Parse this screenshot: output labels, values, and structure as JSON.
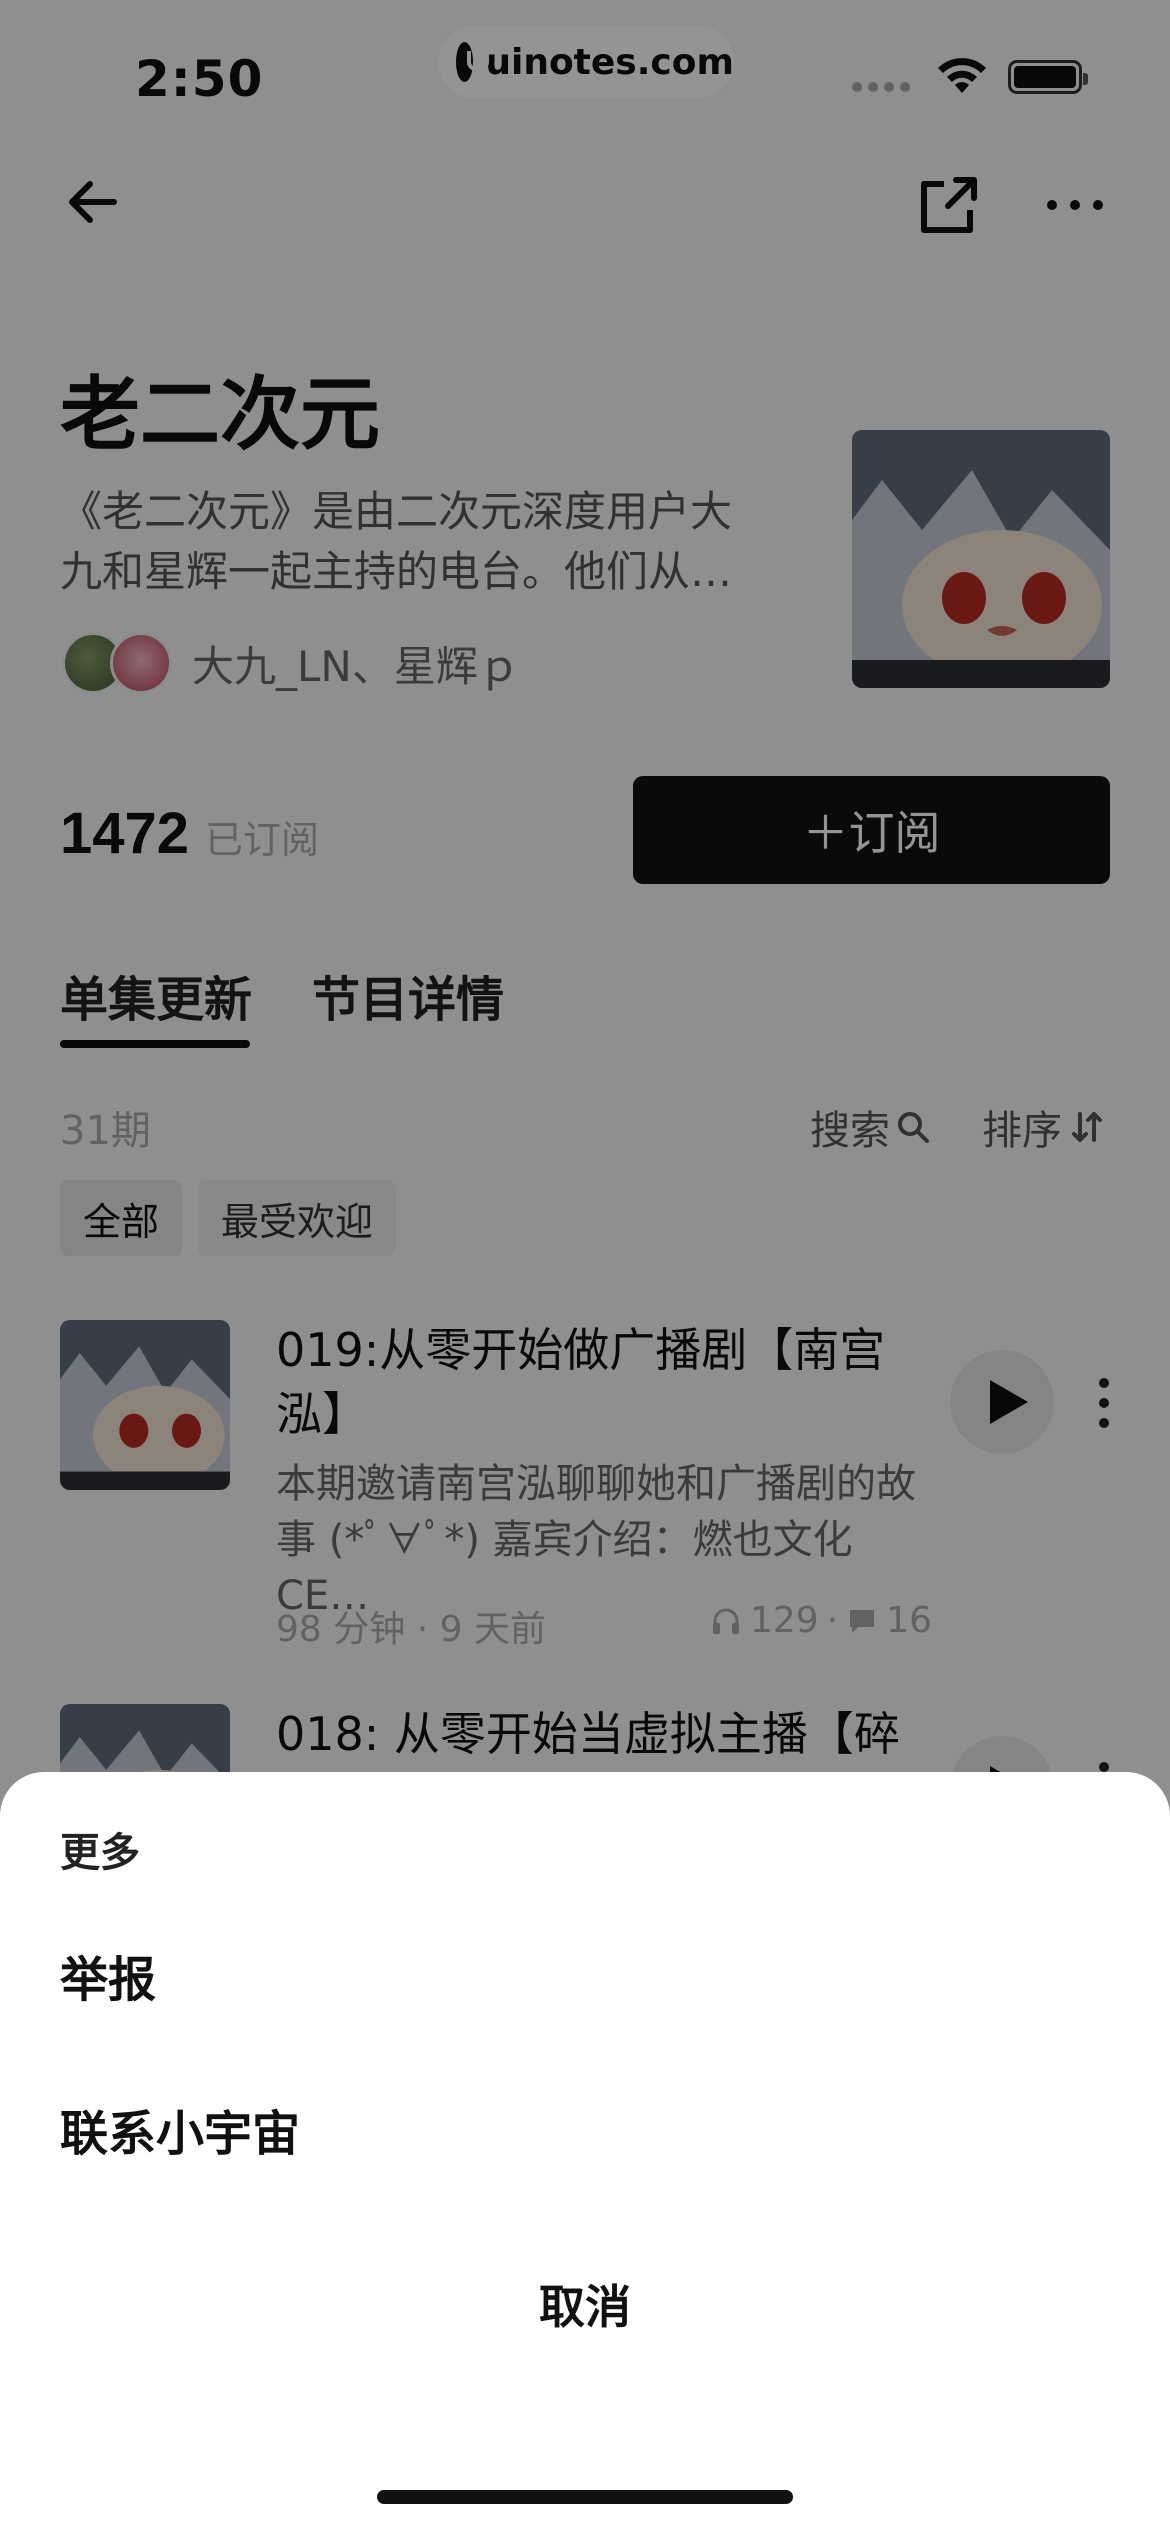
{
  "status_bar": {
    "time": "2:50",
    "url_badge": "uinotes.com"
  },
  "podcast": {
    "title": "老二次元",
    "description": "《老二次元》是由二次元深度用户大九和星辉一起主持的电台。他们从…",
    "hosts": "大九_LN、星辉ｐ",
    "subscriber_count": "1472",
    "subscriber_label": "已订阅",
    "subscribe_button": "＋订阅"
  },
  "tabs": [
    "单集更新",
    "节目详情"
  ],
  "episode_list": {
    "count": "31期",
    "search_label": "搜索",
    "sort_label": "排序",
    "filters": [
      "全部",
      "最受欢迎"
    ]
  },
  "episodes": [
    {
      "title": "019:从零开始做广播剧【南宫泓】",
      "description": "本期邀请南宫泓聊聊她和广播剧的故事 (*ﾟ∀ﾟ*) 嘉宾介绍：燃也文化 CE…",
      "duration": "98 分钟",
      "age": "9 天前",
      "plays": "129",
      "comments": "16"
    },
    {
      "title": "018: 从零开始当虚拟主播【碎"
    }
  ],
  "sheet": {
    "title": "更多",
    "items": [
      "举报",
      "联系小宇宙"
    ],
    "cancel": "取消"
  },
  "colors": {
    "primary": "#121212",
    "background": "#f7f7f7",
    "overlay": "rgba(0,0,0,0.42)"
  }
}
